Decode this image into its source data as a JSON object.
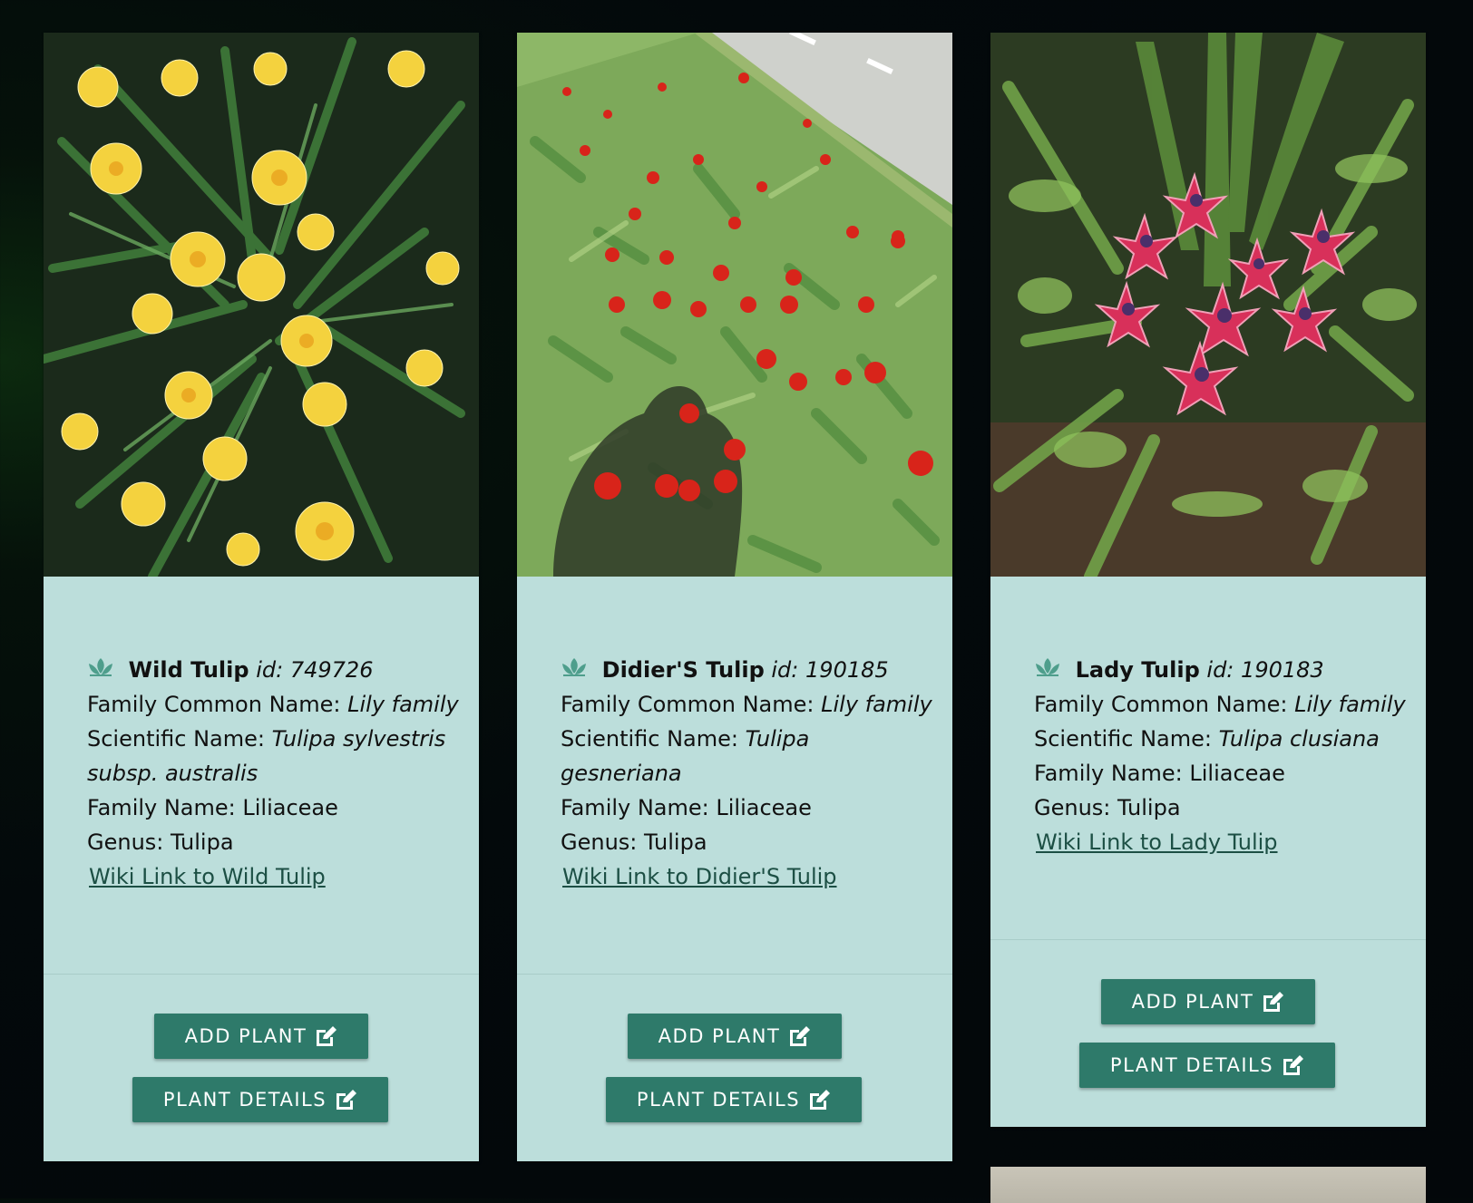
{
  "cards": [
    {
      "name": "Wild Tulip",
      "id_label": "id:",
      "id_value": "749726",
      "family_common_label": "Family Common Name:",
      "family_common_value": "Lily family",
      "scientific_label": "Scientific Name:",
      "scientific_value": "Tulipa sylvestris subsp. australis",
      "family_name_label": "Family Name:",
      "family_name_value": "Liliaceae",
      "genus_label": "Genus:",
      "genus_value": "Tulipa",
      "wiki_link": "Wiki Link to Wild Tulip",
      "add_button": "ADD PLANT",
      "details_button": "PLANT DETAILS"
    },
    {
      "name": "Didier'S Tulip",
      "id_label": "id:",
      "id_value": "190185",
      "family_common_label": "Family Common Name:",
      "family_common_value": "Lily family",
      "scientific_label": "Scientific Name:",
      "scientific_value": "Tulipa gesneriana",
      "family_name_label": "Family Name:",
      "family_name_value": "Liliaceae",
      "genus_label": "Genus:",
      "genus_value": "Tulipa",
      "wiki_link": "Wiki Link to Didier'S Tulip",
      "add_button": "ADD PLANT",
      "details_button": "PLANT DETAILS"
    },
    {
      "name": "Lady Tulip",
      "id_label": "id:",
      "id_value": "190183",
      "family_common_label": "Family Common Name:",
      "family_common_value": "Lily family",
      "scientific_label": "Scientific Name:",
      "scientific_value": "Tulipa clusiana",
      "family_name_label": "Family Name:",
      "family_name_value": "Liliaceae",
      "genus_label": "Genus:",
      "genus_value": "Tulipa",
      "wiki_link": "Wiki Link to Lady Tulip",
      "add_button": "ADD PLANT",
      "details_button": "PLANT DETAILS"
    }
  ],
  "icons": {
    "title_icon": "lotus-icon",
    "button_icon": "edit-icon"
  },
  "colors": {
    "card_background": "#bcdedb",
    "button_background": "#2e7a6a",
    "link_color": "#1c4f44",
    "page_background": "#03070a"
  }
}
